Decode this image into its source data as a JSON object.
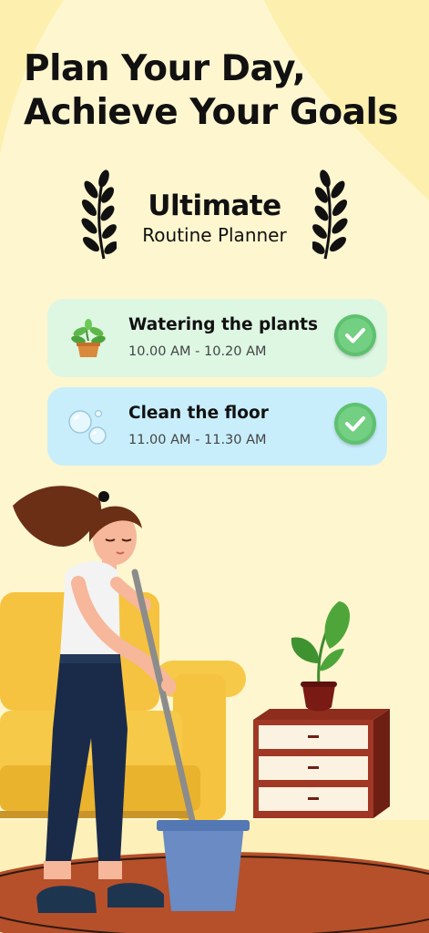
{
  "headline": {
    "line1": "Plan Your Day,",
    "line2": "Achieve Your Goals"
  },
  "badge": {
    "title": "Ultimate",
    "subtitle": "Routine Planner"
  },
  "tasks": [
    {
      "title": "Watering the plants",
      "time": "10.00 AM - 10.20 AM",
      "icon": "potted-plant-icon",
      "status": "done"
    },
    {
      "title": "Clean the floor",
      "time": "11.00 AM - 11.30 AM",
      "icon": "bubbles-icon",
      "status": "done"
    }
  ],
  "colors": {
    "background": "#FEF6CF",
    "task1_bg": "#DDF7E3",
    "task2_bg": "#C8EEFB",
    "check_green": "#5FC16F"
  }
}
